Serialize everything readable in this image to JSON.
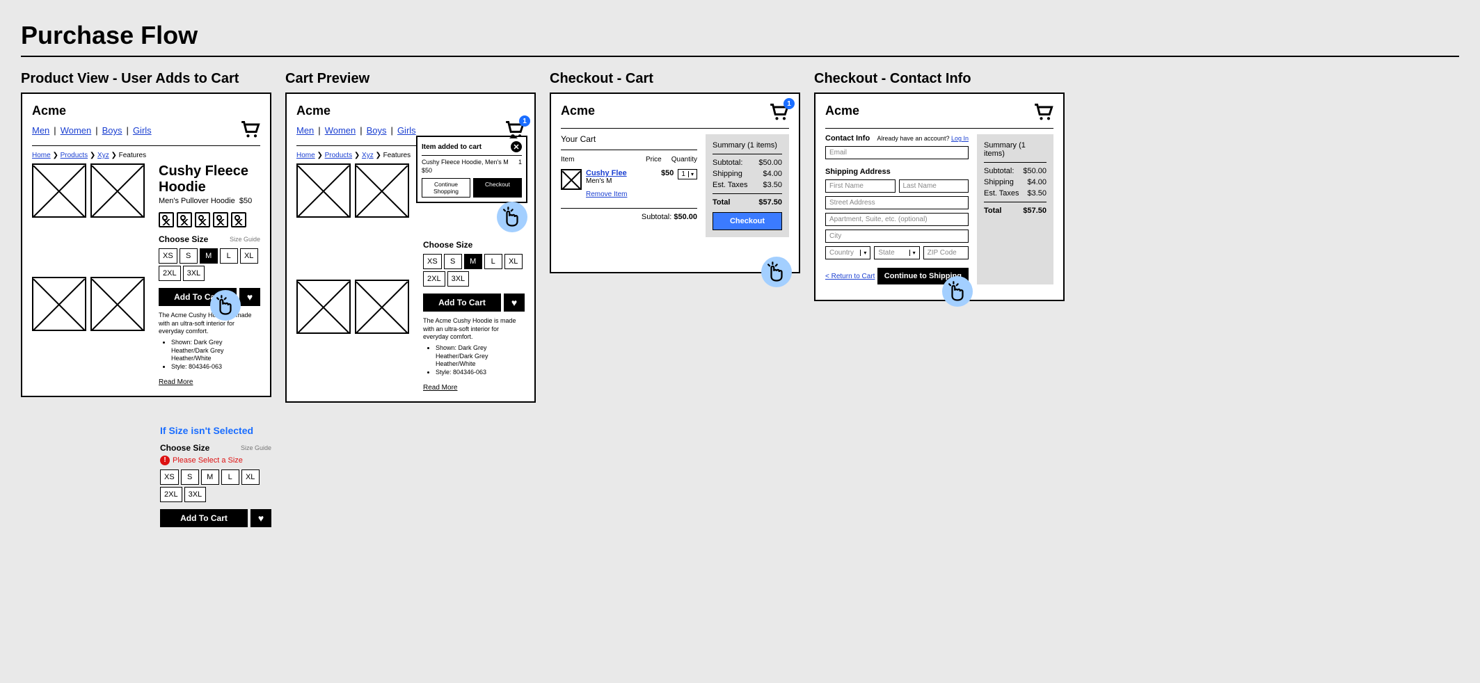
{
  "page_title": "Purchase Flow",
  "brand": "Acme",
  "nav": {
    "men": "Men",
    "women": "Women",
    "boys": "Boys",
    "girls": "Girls"
  },
  "breadcrumb": {
    "home": "Home",
    "products": "Products",
    "xyz": "Xyz",
    "features": "Features"
  },
  "product": {
    "title": "Cushy Fleece Hoodie",
    "subtitle": "Men's Pullover Hoodie",
    "price": "$50",
    "choose_size": "Choose Size",
    "size_guide": "Size Guide",
    "sizes": {
      "xs": "XS",
      "s": "S",
      "m": "M",
      "l": "L",
      "xl": "XL",
      "xxl": "2XL",
      "xxxl": "3XL"
    },
    "add_to_cart": "Add To Cart",
    "desc1": "The Acme Cushy Hoodie is made with an ultra-soft interior for everyday comfort.",
    "bullet1": "Shown: Dark Grey Heather/Dark Grey Heather/White",
    "bullet2": "Style: 804346-063",
    "read_more": "Read More"
  },
  "col1": {
    "title": "Product View - User Adds to Cart"
  },
  "col2": {
    "title": "Cart Preview",
    "cart_badge": "1",
    "pop_title": "Item added to cart",
    "pop_item": "Cushy Fleece Hoodie, Men's M",
    "pop_qty": "1",
    "pop_price": "$50",
    "continue_shopping": "Continue Shopping",
    "checkout": "Checkout"
  },
  "col3": {
    "title": "Checkout - Cart",
    "your_cart": "Your Cart",
    "head_item": "Item",
    "head_price": "Price",
    "head_qty": "Quantity",
    "item_name": "Cushy Flee",
    "item_variant": "Men's M",
    "item_price": "$50",
    "item_qty": "1",
    "remove": "Remove Item",
    "subtotal_label": "Subtotal:",
    "subtotal_value": "$50.00",
    "summary_title": "Summary (1 items)",
    "sum_subtotal_l": "Subtotal:",
    "sum_subtotal_v": "$50.00",
    "sum_shipping_l": "Shipping",
    "sum_shipping_v": "$4.00",
    "sum_tax_l": "Est. Taxes",
    "sum_tax_v": "$3.50",
    "sum_total_l": "Total",
    "sum_total_v": "$57.50",
    "checkout_btn": "Checkout"
  },
  "col4": {
    "title": "Checkout - Contact Info",
    "contact_info": "Contact Info",
    "already": "Already have an account?",
    "login": "Log In",
    "email_ph": "Email",
    "shipping_addr": "Shipping Address",
    "first_ph": "First Name",
    "last_ph": "Last Name",
    "street_ph": "Street Address",
    "apt_ph": "Apartment, Suite, etc. (optional)",
    "city_ph": "City",
    "country_ph": "Country",
    "state_ph": "State",
    "zip_ph": "ZIP Code",
    "return_link": "< Return to Cart",
    "continue_btn": "Continue to Shipping"
  },
  "substate": {
    "title": "If Size isn't Selected",
    "err": "Please Select a Size"
  }
}
